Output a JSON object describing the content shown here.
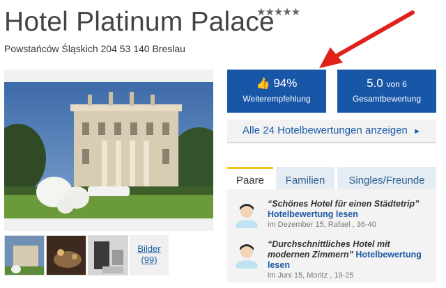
{
  "hotel": {
    "name": "Hotel Platinum Palace",
    "stars": "★★★★★",
    "address": "Powstańców Śląskich 204 53 140 Breslau"
  },
  "ratings": {
    "recommend_value": "94%",
    "recommend_label": "Weiterempfehlung",
    "overall_value": "5.0",
    "overall_of": "von 6",
    "overall_label": "Gesamtbewertung"
  },
  "all_reviews_link": "Alle 24 Hotelbewertungen anzeigen",
  "all_reviews_arrow": "►",
  "photos": {
    "bilder_label": "Bilder",
    "bilder_count": "(99)"
  },
  "tabs": [
    {
      "label": "Paare",
      "active": true
    },
    {
      "label": "Familien",
      "active": false
    },
    {
      "label": "Singles/Freunde",
      "active": false
    }
  ],
  "reviews": [
    {
      "quote": "“Schönes Hotel für einen Städtetrip”",
      "link": "Hotelbewertung lesen",
      "meta": "im Dezember 15, Rafael , 36-40"
    },
    {
      "quote": "“Durchschnittliches Hotel mit modernen Zimmern”",
      "link": "Hotelbewertung lesen",
      "meta": "im Juni 15, Moritz , 19-25"
    }
  ],
  "colors": {
    "accent_blue": "#1856a8",
    "link_blue": "#1a5aa6",
    "tab_active_border": "#f0c419",
    "arrow_red": "#e0201a"
  },
  "icons": {
    "rating_stars": "star-icon",
    "recommend": "thumbs-up-icon",
    "more_arrow": "play-arrow-icon",
    "reviewer": "avatar-icon"
  }
}
